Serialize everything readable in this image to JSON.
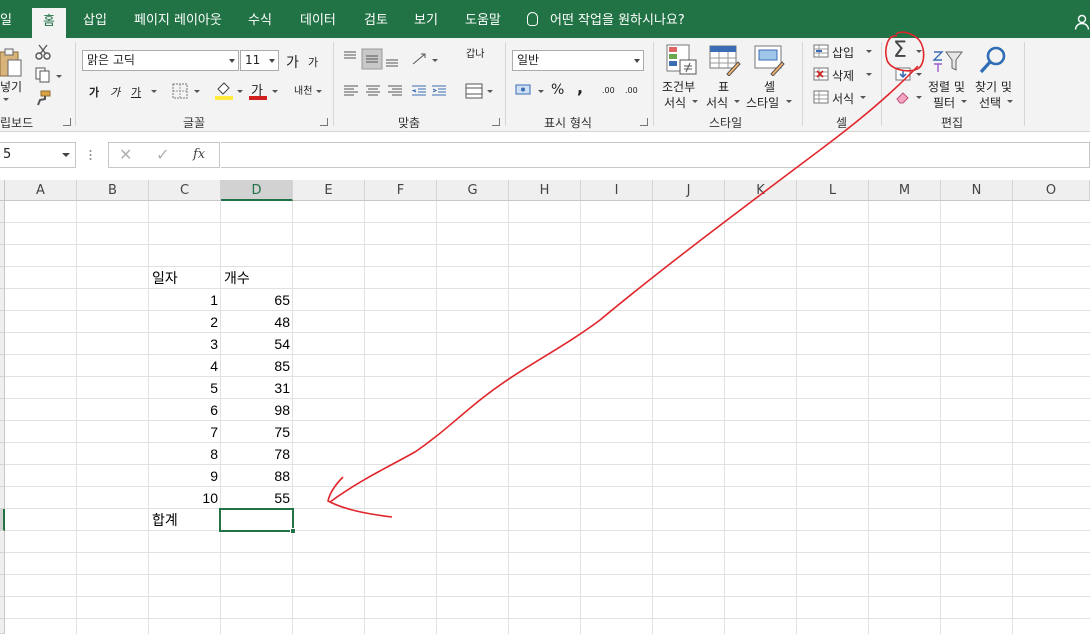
{
  "tabs": {
    "file": "일",
    "home": "홈",
    "insert": "삽입",
    "page_layout": "페이지 레이아웃",
    "formulas": "수식",
    "data": "데이터",
    "review": "검토",
    "view": "보기",
    "help": "도움말"
  },
  "tell_me": "어떤 작업을 원하시나요?",
  "ribbon": {
    "clipboard": {
      "paste_label": "넣기",
      "group_label": "립보드"
    },
    "font": {
      "name": "맑은 고딕",
      "size": "11",
      "grow": "가",
      "shrink": "가",
      "bold": "가",
      "italic": "가",
      "underline": "가",
      "font_color_glyph": "가",
      "phonetic": "내천",
      "group_label": "글꼴"
    },
    "alignment": {
      "wrap": "갑나",
      "group_label": "맞춤"
    },
    "number": {
      "format": "일반",
      "percent": "%",
      "comma": ",",
      "inc_decimal": ".00",
      "dec_decimal": ".00",
      "group_label": "표시 형식"
    },
    "styles": {
      "conditional_line1": "조건부",
      "conditional_line2": "서식",
      "table_line1": "표",
      "table_line2": "서식",
      "cell_line1": "셀",
      "cell_line2": "스타일",
      "group_label": "스타일"
    },
    "cells": {
      "insert": "삽입",
      "delete": "삭제",
      "format": "서식",
      "group_label": "셀"
    },
    "editing": {
      "sort_line1": "정렬 및",
      "sort_line2": "필터",
      "find_line1": "찾기 및",
      "find_line2": "선택",
      "group_label": "편집"
    }
  },
  "formula_bar": {
    "name_box": "5",
    "cancel": "✕",
    "enter": "✓",
    "fx": "fx",
    "formula": ""
  },
  "grid": {
    "columns": [
      "A",
      "B",
      "C",
      "D",
      "E",
      "F",
      "G",
      "H",
      "I",
      "J",
      "K",
      "L",
      "M",
      "N",
      "O"
    ],
    "selected_column": "D",
    "header_date": "일자",
    "header_count": "개수",
    "rows": [
      {
        "day": "1",
        "count": "65"
      },
      {
        "day": "2",
        "count": "48"
      },
      {
        "day": "3",
        "count": "54"
      },
      {
        "day": "4",
        "count": "85"
      },
      {
        "day": "5",
        "count": "31"
      },
      {
        "day": "6",
        "count": "98"
      },
      {
        "day": "7",
        "count": "75"
      },
      {
        "day": "8",
        "count": "78"
      },
      {
        "day": "9",
        "count": "88"
      },
      {
        "day": "10",
        "count": "55"
      }
    ],
    "total_label": "합계"
  },
  "colors": {
    "accent": "#217346",
    "annotation": "#e0262b"
  }
}
